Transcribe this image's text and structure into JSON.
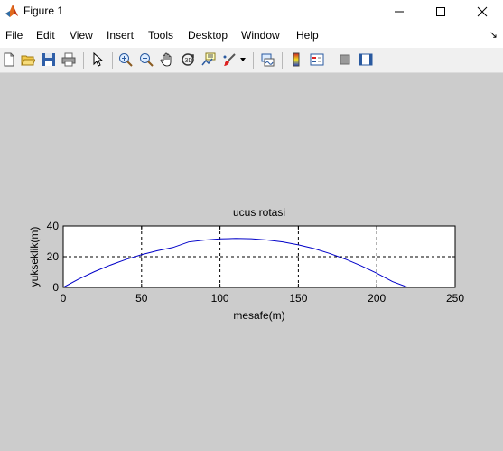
{
  "window": {
    "title": "Figure 1",
    "minimize_glyph": "─",
    "maximize_glyph": "☐",
    "close_glyph": "✕"
  },
  "menu": {
    "items": [
      "File",
      "Edit",
      "View",
      "Insert",
      "Tools",
      "Desktop",
      "Window",
      "Help"
    ],
    "extra_glyph": "↘"
  },
  "toolbar": {
    "icons": [
      "new-figure-icon",
      "open-file-icon",
      "save-icon",
      "print-icon",
      "edit-plot-arrow-icon",
      "zoom-in-icon",
      "zoom-out-icon",
      "pan-hand-icon",
      "rotate-3d-icon",
      "data-cursor-icon",
      "brush-icon",
      "brush-dropdown-icon",
      "link-plot-icon",
      "insert-colorbar-icon",
      "insert-legend-icon",
      "hide-plot-tools-icon",
      "show-plot-tools-icon"
    ]
  },
  "chart_data": {
    "type": "line",
    "title": "ucus rotasi",
    "xlabel": "mesafe(m)",
    "ylabel": "yukseklik(m)",
    "xlim": [
      0,
      250
    ],
    "ylim": [
      0,
      40
    ],
    "xticks": [
      "0",
      "50",
      "100",
      "150",
      "200",
      "250"
    ],
    "yticks": [
      "0",
      "20",
      "40"
    ],
    "grid": true,
    "line_color": "#0000c8",
    "series": [
      {
        "x": [
          0,
          10,
          20,
          30,
          40,
          50,
          60,
          70,
          80,
          90,
          100,
          110,
          120,
          130,
          140,
          150,
          160,
          170,
          180,
          190,
          200,
          210,
          220
        ],
        "y": [
          0,
          5.5,
          10.3,
          14.5,
          18.2,
          21.3,
          23.9,
          26.0,
          29.6,
          30.8,
          31.6,
          31.9,
          31.7,
          30.9,
          29.6,
          27.7,
          25.3,
          22.1,
          18.4,
          14.1,
          9.2,
          3.8,
          0
        ]
      }
    ]
  }
}
